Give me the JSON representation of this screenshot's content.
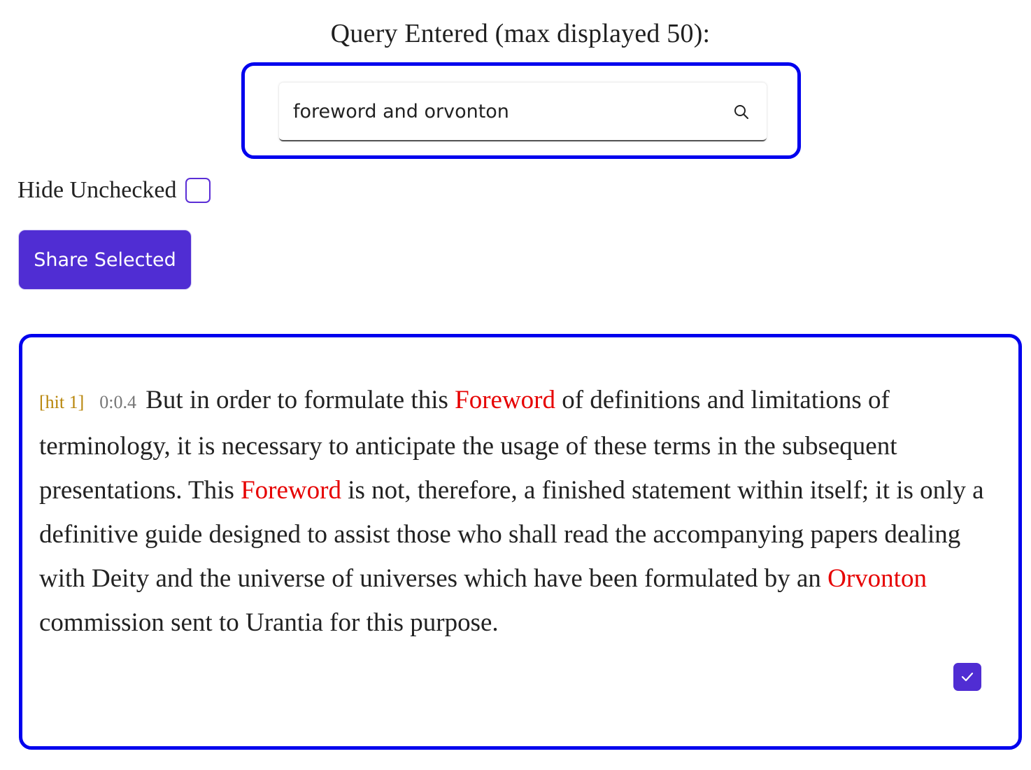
{
  "heading": "Query Entered (max displayed 50):",
  "search": {
    "value": "foreword and orvonton",
    "icon": "search-icon"
  },
  "hide_unchecked": {
    "label": "Hide Unchecked",
    "checked": false
  },
  "share_button": {
    "label": "Share Selected",
    "color": "#502dd3"
  },
  "result": {
    "hit_label": "[hit 1]",
    "reference": "0:0.4",
    "segments": [
      "But in order to formulate this ",
      "Foreword",
      " of definitions and limitations of terminology, it is necessary to anticipate the usage of these terms in the subsequent presentations. This ",
      "Foreword",
      " is not, therefore, a finished statement within itself; it is only a definitive guide designed to assist those who shall read the accompanying papers dealing with Deity and the universe of universes which have been formulated by an ",
      "Orvonton",
      " commission sent to Urantia for this purpose."
    ],
    "checked": true
  },
  "colors": {
    "frame_border": "#0000ee",
    "highlight": "#e60000",
    "hit_label": "#b8860b"
  }
}
